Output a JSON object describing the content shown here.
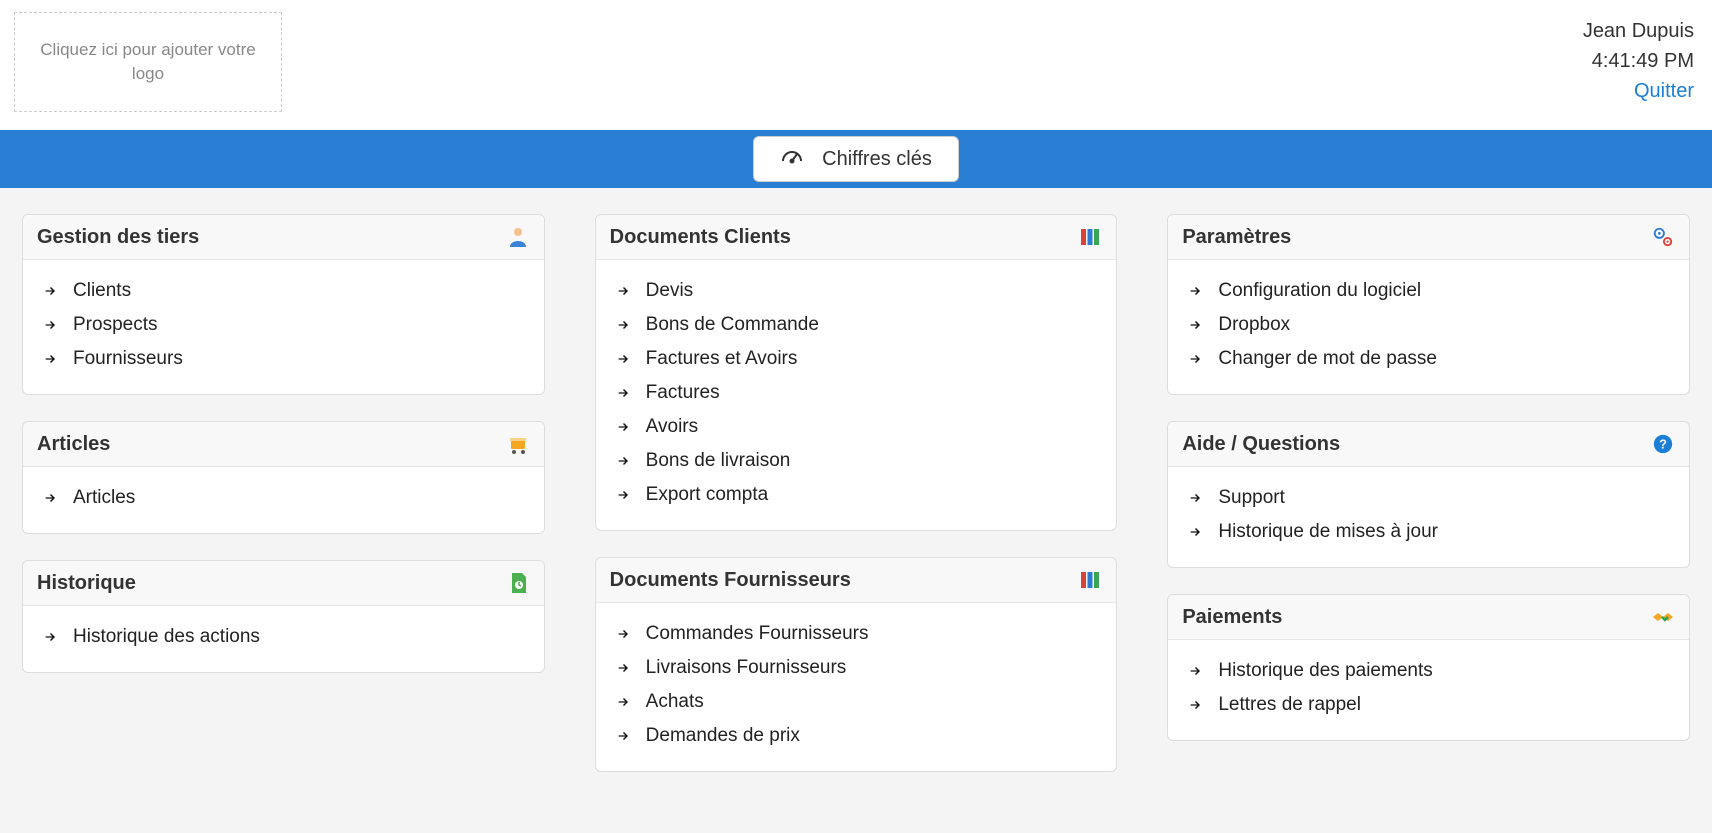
{
  "header": {
    "logo_placeholder": "Cliquez ici pour ajouter votre logo",
    "user_name": "Jean Dupuis",
    "time": "4:41:49 PM",
    "quit_label": "Quitter"
  },
  "blue_bar": {
    "kpi_button": "Chiffres clés"
  },
  "columns": [
    {
      "cards": [
        {
          "title": "Gestion des tiers",
          "icon": "person-icon",
          "items": [
            "Clients",
            "Prospects",
            "Fournisseurs"
          ]
        },
        {
          "title": "Articles",
          "icon": "cart-icon",
          "items": [
            "Articles"
          ]
        },
        {
          "title": "Historique",
          "icon": "history-icon",
          "items": [
            "Historique des actions"
          ]
        }
      ]
    },
    {
      "cards": [
        {
          "title": "Documents Clients",
          "icon": "binders-icon",
          "items": [
            "Devis",
            "Bons de Commande",
            "Factures et Avoirs",
            "Factures",
            "Avoirs",
            "Bons de livraison",
            "Export compta"
          ]
        },
        {
          "title": "Documents Fournisseurs",
          "icon": "binders-icon",
          "items": [
            "Commandes Fournisseurs",
            "Livraisons Fournisseurs",
            "Achats",
            "Demandes de prix"
          ]
        }
      ]
    },
    {
      "cards": [
        {
          "title": "Paramètres",
          "icon": "gears-icon",
          "items": [
            "Configuration du logiciel",
            "Dropbox",
            "Changer de mot de passe"
          ]
        },
        {
          "title": "Aide / Questions",
          "icon": "help-icon",
          "items": [
            "Support",
            "Historique de mises à jour"
          ]
        },
        {
          "title": "Paiements",
          "icon": "handshake-icon",
          "items": [
            "Historique des paiements",
            "Lettres de rappel"
          ]
        }
      ]
    }
  ]
}
